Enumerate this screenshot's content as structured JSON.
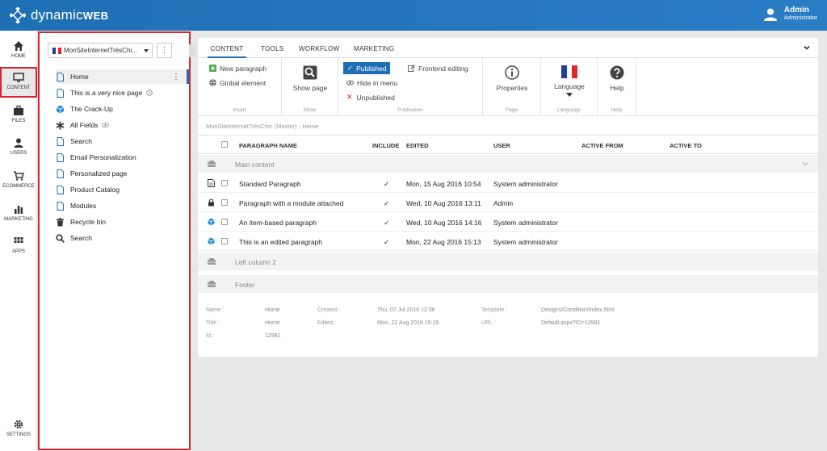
{
  "app": {
    "logo_text_a": "dynamic",
    "logo_text_b": "WEB",
    "user_name": "Admin",
    "user_role": "Administrator"
  },
  "colors": {
    "topbar": "#2a7cc4",
    "accent": "#1f6fb5",
    "highlight": "#d9262c",
    "check": "#4caf50"
  },
  "leftnav": {
    "items": [
      {
        "label": "HOME",
        "icon": "home-icon"
      },
      {
        "label": "CONTENT",
        "icon": "monitor-icon"
      },
      {
        "label": "FILES",
        "icon": "briefcase-icon"
      },
      {
        "label": "USERS",
        "icon": "user-icon"
      },
      {
        "label": "ECOMMERCE",
        "icon": "cart-icon"
      },
      {
        "label": "MARKETING",
        "icon": "bar-chart-icon"
      },
      {
        "label": "APPS",
        "icon": "grid-icon"
      }
    ],
    "settings_label": "SETTINGS"
  },
  "tree": {
    "site_name": "MonSiteInternetTrèsChi...",
    "site_more": "⋮",
    "items": [
      {
        "label": "Home",
        "icon": "page-icon"
      },
      {
        "label": "This is a very nice page",
        "icon": "page-icon"
      },
      {
        "label": "The Crack-Up",
        "icon": "cube-icon"
      },
      {
        "label": "All Fields",
        "icon": "asterisk-icon"
      },
      {
        "label": "Search",
        "icon": "page-icon"
      },
      {
        "label": "Email Personalization",
        "icon": "page-icon"
      },
      {
        "label": "Personalized page",
        "icon": "page-icon"
      },
      {
        "label": "Product Catalog",
        "icon": "page-icon"
      },
      {
        "label": "Modules",
        "icon": "page-icon"
      },
      {
        "label": "Recycle bin",
        "icon": "trash-icon"
      },
      {
        "label": "Search",
        "icon": "search-icon"
      }
    ],
    "home_dots": "⋮"
  },
  "tabs": [
    "CONTENT",
    "TOOLS",
    "WORKFLOW",
    "MARKETING"
  ],
  "ribbon": {
    "insert": {
      "title": "Insert",
      "new_paragraph": "New paragraph",
      "global_element": "Global element"
    },
    "show": {
      "title": "Show",
      "show_page": "Show page"
    },
    "publication": {
      "title": "Publication",
      "published": "Published",
      "hide_in_menu": "Hide in menu",
      "unpublished": "Unpublished",
      "frontend_editing": "Frontend editing"
    },
    "page": {
      "title": "Page",
      "properties": "Properties"
    },
    "language": {
      "title": "Language",
      "language": "Language"
    },
    "help": {
      "title": "Help",
      "help": "Help"
    }
  },
  "breadcrumb": {
    "root": "MonSiteInternetTrèsChic (Master)",
    "sep": "›",
    "current": "Home"
  },
  "table": {
    "headers": [
      "PARAGRAPH NAME",
      "INCLUDE",
      "EDITED",
      "USER",
      "ACTIVE FROM",
      "ACTIVE TO"
    ],
    "sections": [
      {
        "label": "Main content"
      },
      {
        "label": "Left column 2"
      },
      {
        "label": "Footer"
      }
    ],
    "rows": [
      {
        "name": "Standard Paragraph",
        "include": "✓",
        "edited": "Mon, 15 Aug 2016 10:54",
        "user": "System administrator",
        "icon": "document-icon"
      },
      {
        "name": "Paragraph with a module attached",
        "include": "✓",
        "edited": "Wed, 10 Aug 2016 13:11",
        "user": "Admin",
        "icon": "lock-icon"
      },
      {
        "name": "An item-based paragraph",
        "include": "✓",
        "edited": "Wed, 10 Aug 2016 14:16",
        "user": "System administrator",
        "icon": "cube-icon"
      },
      {
        "name": "This is an edited paragraph",
        "include": "✓",
        "edited": "Mon, 22 Aug 2016 15:13",
        "user": "System administrator",
        "icon": "cube-icon"
      }
    ]
  },
  "meta": {
    "name_label": "Name :",
    "name_value": "Home",
    "title_label": "Title :",
    "title_value": "Home",
    "id_label": "Id :",
    "id_value": "12981",
    "created_label": "Created :",
    "created_value": "Thu, 07 Jul 2016 12:36",
    "edited_label": "Edited :",
    "edited_value": "Mon, 22 Aug 2016 15:19",
    "template_label": "Template :",
    "template_value": "Designs/Condition/index.html",
    "url_label": "URL :",
    "url_value": "Default.aspx?ID=12981"
  }
}
